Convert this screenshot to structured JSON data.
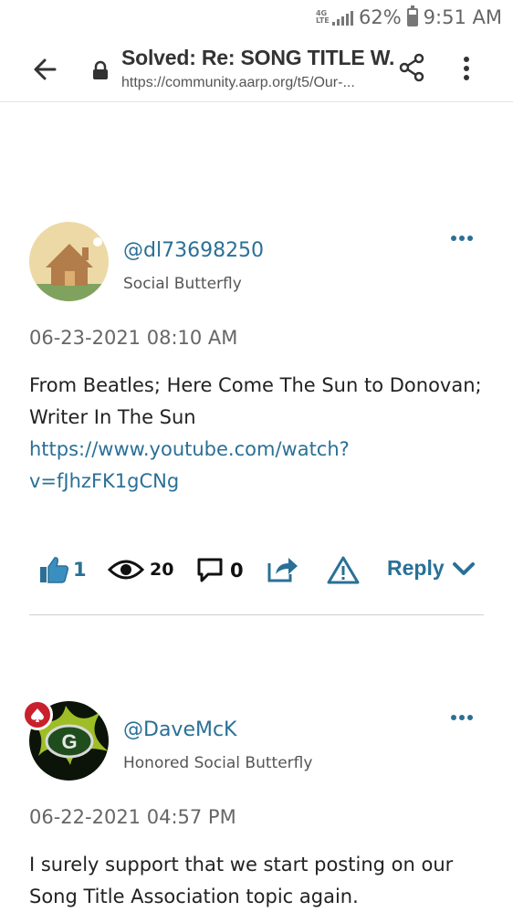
{
  "status_bar": {
    "network": "4G LTE",
    "battery": "62%",
    "time": "9:51 AM"
  },
  "browser": {
    "title": "Solved: Re: SONG TITLE W...",
    "url": "https://community.aarp.org/t5/Our-..."
  },
  "posts": [
    {
      "username": "@dl73698250",
      "rank": "Social Butterfly",
      "timestamp": "06-23-2021 08:10 AM",
      "text_lines": [
        "From Beatles; Here Come The Sun to Donovan;",
        "Writer In The Sun"
      ],
      "link_lines": [
        "https://www.youtube.com/watch?",
        "v=fJhzFK1gCNg"
      ],
      "likes": "1",
      "views": "20",
      "comments": "0",
      "reply_label": "Reply"
    },
    {
      "username": "@DaveMcK",
      "rank": "Honored Social Butterfly",
      "timestamp": "06-22-2021 04:57 PM",
      "text_lines": [
        "I surely support that we start posting on our",
        "Song Title Association topic again."
      ]
    }
  ],
  "colors": {
    "link": "#2a7096",
    "badge": "#c8202c"
  }
}
